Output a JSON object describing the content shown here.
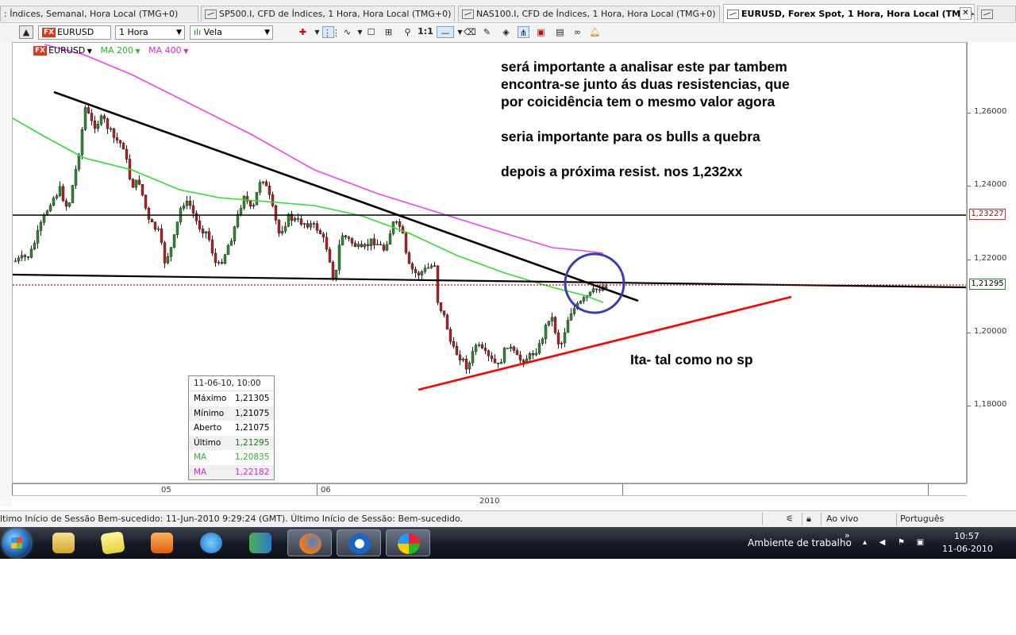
{
  "tabs": [
    {
      "label": ": Índices, Semanal, Hora Local (TMG+0)",
      "active": false
    },
    {
      "label": "SP500.I, CFD de Índices, 1 Hora, Hora Local (TMG+0)",
      "active": false
    },
    {
      "label": "NAS100.I, CFD de Índices, 1 Hora, Hora Local (TMG+0)",
      "active": false
    },
    {
      "label": "EURUSD, Forex Spot, 1 Hora, Hora Local (TMG+0)",
      "active": true
    }
  ],
  "toolbar": {
    "symbol": "EURUSD",
    "fx_badge": "FX",
    "timeframe": "1 Hora",
    "chart_type": "Vela",
    "one_to_one": "1:1"
  },
  "legend": {
    "symbol": "EURUSD",
    "ma1": "MA 200",
    "ma2": "MA 400",
    "ma1_color": "#00cc00",
    "ma2_color": "#e020e0"
  },
  "annotations": {
    "line1": "será importante a analisar este par tambem",
    "line2": "encontra-se junto ás duas resistencias, que",
    "line3": "por coicidência tem o mesmo valor agora",
    "line4": "seria importante para os bulls a quebra",
    "line5": "depois a próxima resist. nos 1,232xx",
    "line6": "Ita- tal como no sp"
  },
  "price_axis": {
    "labels": [
      "1,26000",
      "1,24000",
      "1,22000",
      "1,20000",
      "1,18000"
    ],
    "resistance_tag": "1,23227",
    "current_tag": "1,21295"
  },
  "time_axis": {
    "day1": "05",
    "day2": "06",
    "year": "2010"
  },
  "data_window": {
    "title": "11-06-10, 10:00",
    "rows": [
      {
        "k": "Máximo",
        "v": "1,21305"
      },
      {
        "k": "Mínimo",
        "v": "1,21075"
      },
      {
        "k": "Aberto",
        "v": "1,21075"
      },
      {
        "k": "Último",
        "v": "1,21295"
      },
      {
        "k": "MA",
        "v": "1,20835"
      },
      {
        "k": "MA",
        "v": "1,22182"
      }
    ]
  },
  "statusbar": {
    "message": "ltimo Início de Sessão Bem-sucedido: 11-Jun-2010 9:29:24 (GMT). Último Início de Sessão: Bem-sucedido.",
    "live": "Ao vivo",
    "language": "Português"
  },
  "taskbar": {
    "desktop_label": "Ambiente de trabalho",
    "time": "10:57",
    "date": "11-06-2010"
  },
  "colors": {
    "bull": "#2e8b2e",
    "bear": "#b22222",
    "ma200": "#33dd33",
    "ma400": "#ee44ee",
    "support": "#ff0000",
    "circle": "#3a3ab8",
    "current_price": "#d00000"
  }
}
